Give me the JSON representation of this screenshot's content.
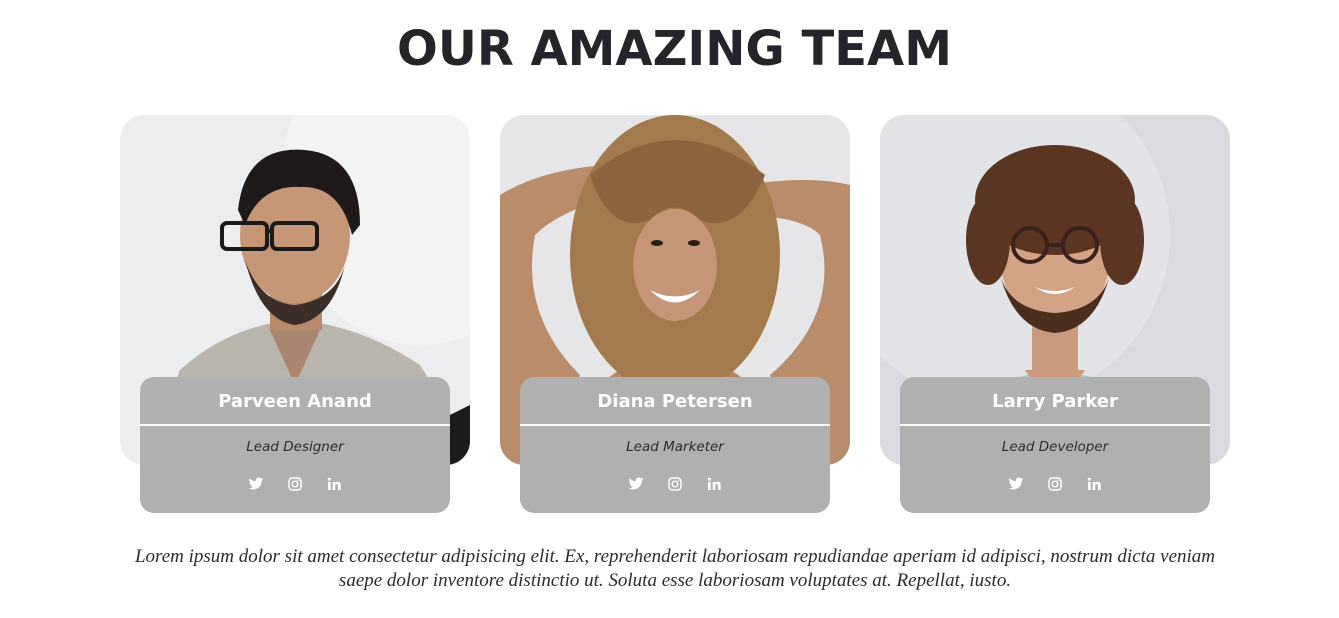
{
  "page": {
    "heading": "OUR AMAZING TEAM",
    "description": "Lorem ipsum dolor sit amet consectetur adipisicing elit. Ex, reprehenderit laboriosam repudiandae aperiam id adipisci, nostrum dicta veniam saepe dolor inventore distinctio ut. Soluta esse laboriosam voluptates at. Repellat, iusto."
  },
  "team": [
    {
      "name": "Parveen Anand",
      "role": "Lead Designer",
      "socials": [
        "twitter-icon",
        "instagram-icon",
        "linkedin-icon"
      ]
    },
    {
      "name": "Diana Petersen",
      "role": "Lead Marketer",
      "socials": [
        "twitter-icon",
        "instagram-icon",
        "linkedin-icon"
      ]
    },
    {
      "name": "Larry Parker",
      "role": "Lead Developer",
      "socials": [
        "twitter-icon",
        "instagram-icon",
        "linkedin-icon"
      ]
    }
  ],
  "colors": {
    "heading": "#23252b",
    "info_panel": "#b0b0b0",
    "name_text": "#ffffff",
    "role_text": "#2c2c2c",
    "body_text": "#2b2b2b"
  }
}
